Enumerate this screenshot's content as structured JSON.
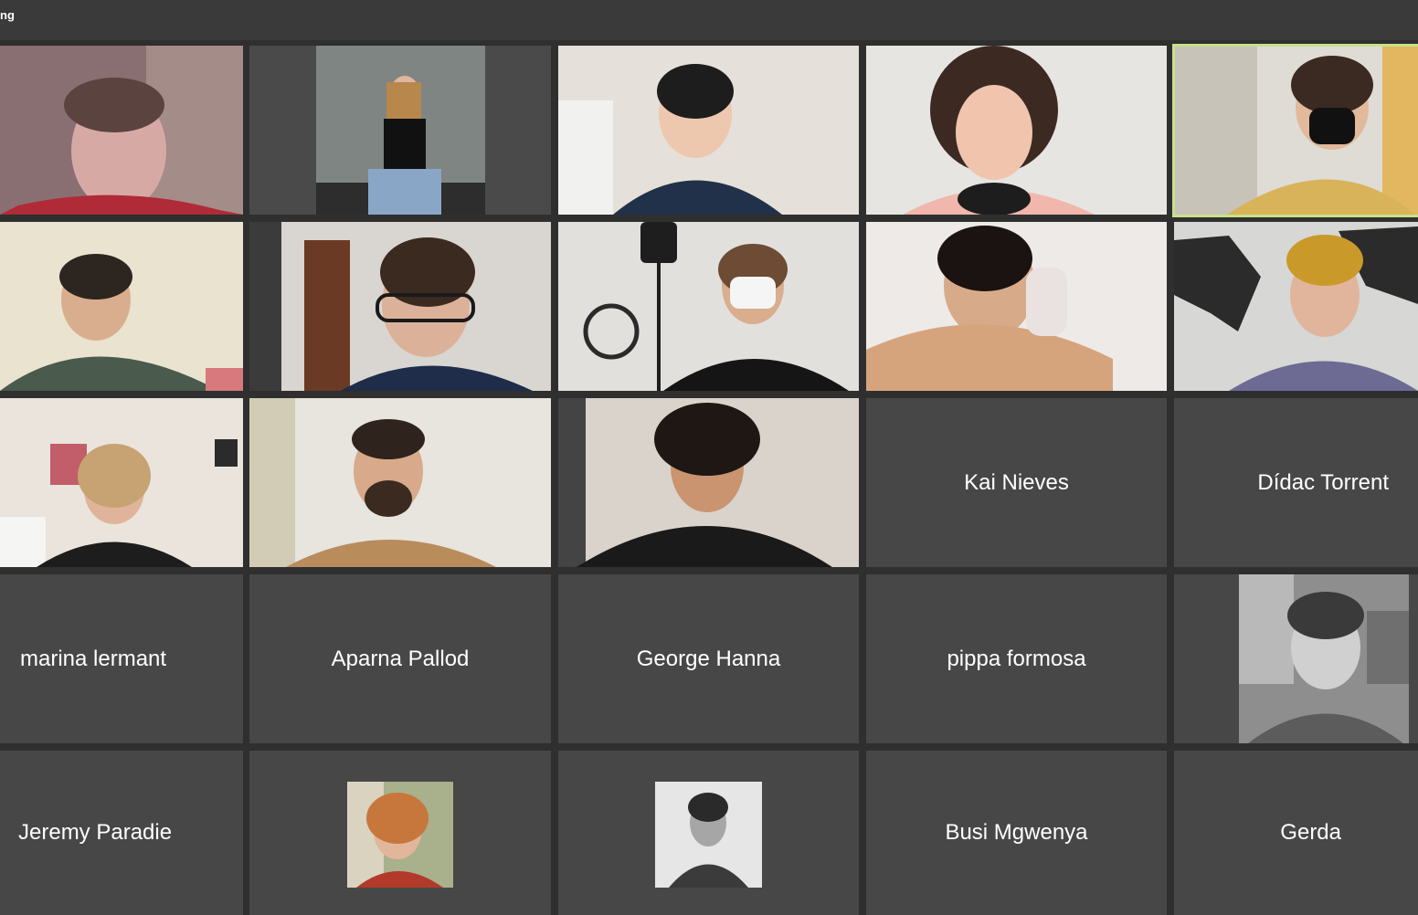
{
  "window": {
    "title": "ng"
  },
  "participants": [
    {
      "name": "",
      "video": true
    },
    {
      "name": "",
      "video": true
    },
    {
      "name": "",
      "video": true
    },
    {
      "name": "",
      "video": true
    },
    {
      "name": "",
      "video": true,
      "active_speaker": true
    },
    {
      "name": "",
      "video": true
    },
    {
      "name": "",
      "video": true
    },
    {
      "name": "",
      "video": true
    },
    {
      "name": "",
      "video": true
    },
    {
      "name": "",
      "video": true
    },
    {
      "name": "",
      "video": true
    },
    {
      "name": "",
      "video": true
    },
    {
      "name": "",
      "video": true
    },
    {
      "name": "Kai Nieves",
      "video": false
    },
    {
      "name": "Dídac Torrent",
      "video": false
    },
    {
      "name": "marina lermant",
      "video": false
    },
    {
      "name": "Aparna Pallod",
      "video": false
    },
    {
      "name": "George Hanna",
      "video": false
    },
    {
      "name": "pippa formosa",
      "video": false
    },
    {
      "name": "",
      "video": false,
      "avatar": "profile-photo-bw"
    },
    {
      "name": "Jeremy Paradie",
      "video": false
    },
    {
      "name": "",
      "video": false,
      "avatar": "profile-photo-color"
    },
    {
      "name": "",
      "video": false,
      "avatar": "profile-photo-bw"
    },
    {
      "name": "Busi Mgwenya",
      "video": false
    },
    {
      "name": "Gerda",
      "video": false
    }
  ],
  "colors": {
    "background": "#2f2f2f",
    "tile": "#474747",
    "active_border": "#c7e08a",
    "text": "#ffffff"
  }
}
